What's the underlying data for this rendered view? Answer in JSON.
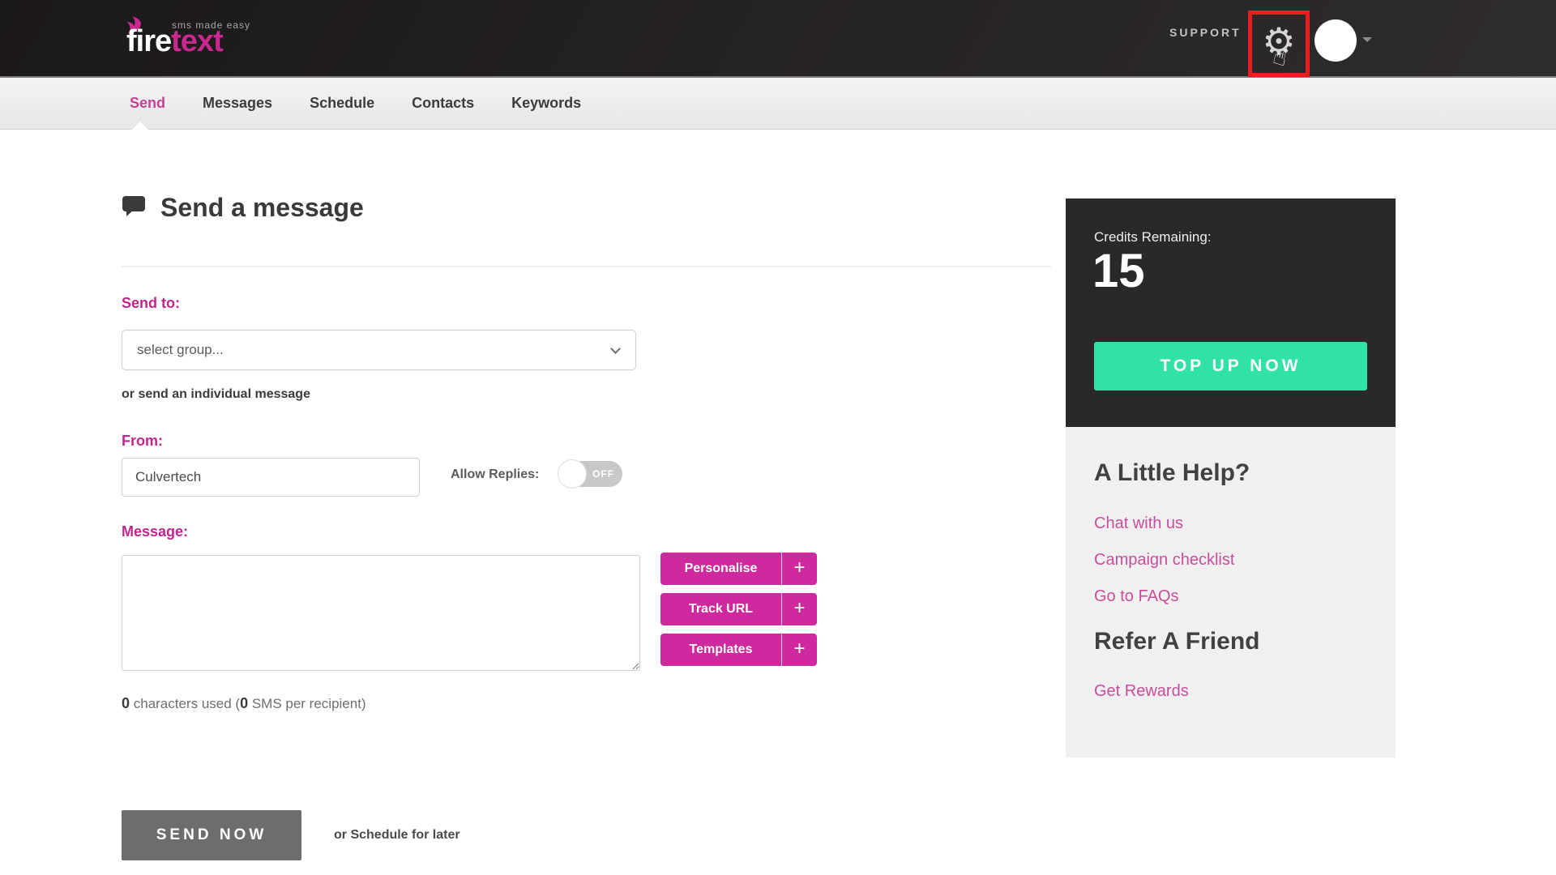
{
  "header": {
    "logo": {
      "tagline": "sms made easy",
      "brand_fire": "fire",
      "brand_text": "text"
    },
    "support_label": "SUPPORT"
  },
  "icons": {
    "gear": "⚙",
    "hand_cursor": "☝"
  },
  "nav": {
    "items": [
      {
        "label": "Send",
        "active": true
      },
      {
        "label": "Messages",
        "active": false
      },
      {
        "label": "Schedule",
        "active": false
      },
      {
        "label": "Contacts",
        "active": false
      },
      {
        "label": "Keywords",
        "active": false
      }
    ]
  },
  "main": {
    "title": "Send a message",
    "send_to_label": "Send to:",
    "group_select_value": "select group...",
    "individual_message_text": "or send an individual message",
    "from_label": "From:",
    "from_value": "Culvertech",
    "allow_replies_label": "Allow Replies:",
    "allow_replies_state": "OFF",
    "message_label": "Message:",
    "message_value": "",
    "tools": [
      {
        "label": "Personalise"
      },
      {
        "label": "Track URL"
      },
      {
        "label": "Templates"
      }
    ],
    "tool_plus": "+",
    "counter": {
      "count": "0",
      "mid": " characters used (",
      "sms_count": "0",
      "tail": " SMS per recipient)"
    },
    "send_now_label": "SEND NOW",
    "schedule_text": "or Schedule for later"
  },
  "sidebar": {
    "credits": {
      "label": "Credits Remaining:",
      "value": "15",
      "top_up_label": "TOP UP NOW"
    },
    "help": {
      "title": "A Little Help?",
      "links": [
        "Chat with us",
        "Campaign checklist",
        "Go to FAQs"
      ],
      "refer_title": "Refer A Friend",
      "refer_link": "Get Rewards"
    }
  },
  "colors": {
    "brand_pink": "#c9298f",
    "accent_magenta": "#ce2a9d",
    "mint_green": "#30e2a5",
    "annotation_red": "#e71f1f",
    "dark_panel": "#2b2829",
    "send_now_gray": "#6f6c6c"
  }
}
